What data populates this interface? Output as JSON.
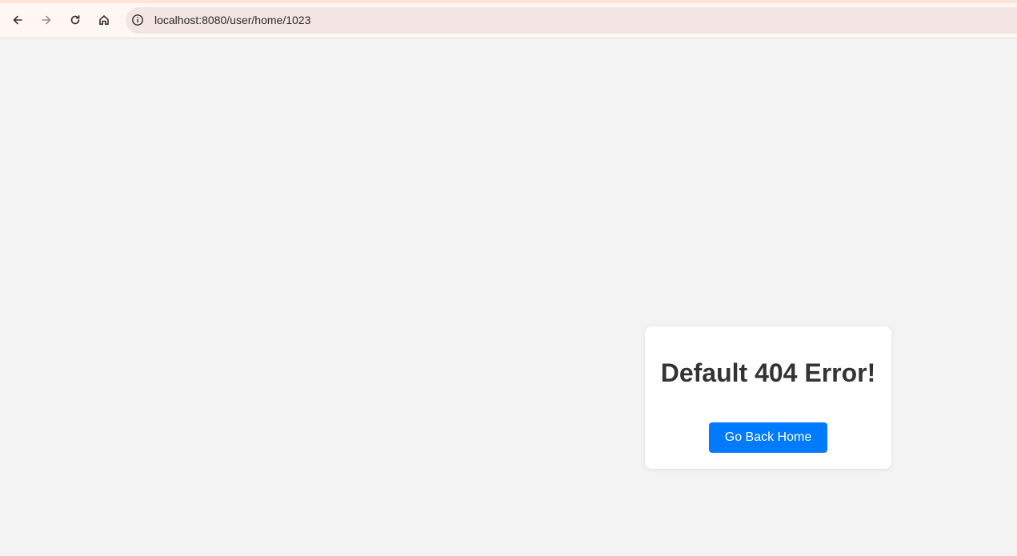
{
  "browser": {
    "url": "localhost:8080/user/home/1023",
    "nav_icons": [
      "back-arrow-icon",
      "forward-arrow-icon",
      "reload-icon",
      "home-icon",
      "info-icon"
    ]
  },
  "error_card": {
    "title": "Default 404 Error!",
    "button_label": "Go Back Home"
  },
  "colors": {
    "button_bg": "#007bff",
    "page_bg": "#f3f3f3",
    "title_text": "#333333",
    "toolbar_bg": "#fff7f4",
    "address_bar_bg": "#f3e5e3"
  }
}
